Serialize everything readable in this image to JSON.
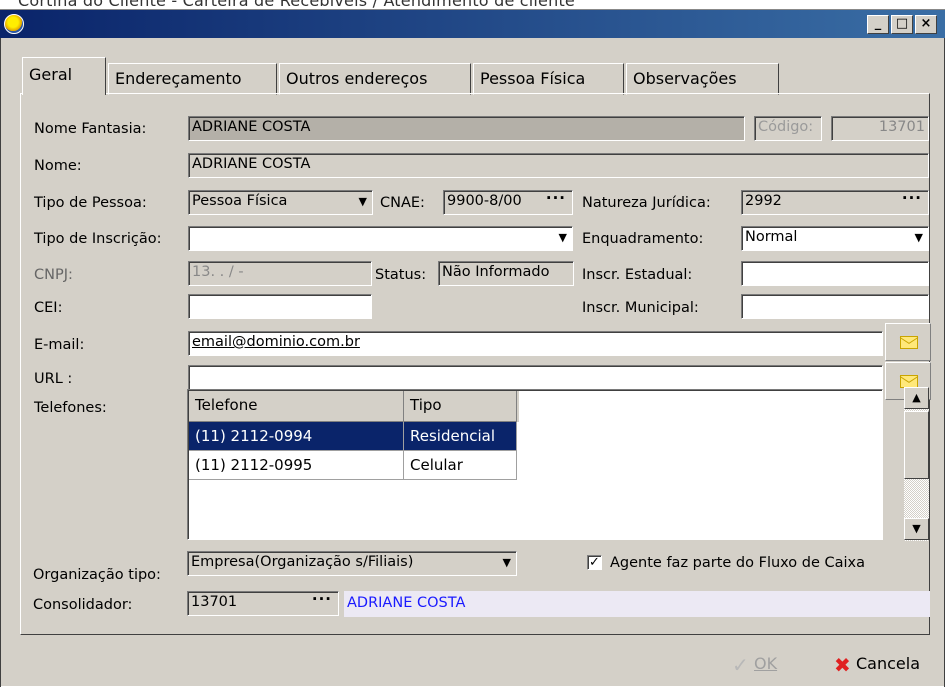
{
  "caption": "Cortina do Cliente - Carteira de Recebíveis / Atendimento de cliente",
  "window": {
    "min": "_",
    "max": "□",
    "close": "×"
  },
  "tabs": [
    {
      "label": "Geral"
    },
    {
      "label": "Endereçamento"
    },
    {
      "label": "Outros endereços"
    },
    {
      "label": "Pessoa Física"
    },
    {
      "label": "Observações"
    }
  ],
  "form": {
    "nome_fantasia_label": "Nome Fantasia:",
    "nome_fantasia": "ADRIANE COSTA",
    "codigo_label": "Código:",
    "codigo": "13701",
    "nome_label": "Nome:",
    "nome": "ADRIANE COSTA",
    "tipo_pessoa_label": "Tipo de Pessoa:",
    "tipo_pessoa": "Pessoa Física",
    "cnae_label": "CNAE:",
    "cnae": "9900-8/00",
    "natureza_label": "Natureza Jurídica:",
    "natureza": "2992",
    "tipo_inscricao_label": "Tipo de Inscrição:",
    "tipo_inscricao": "",
    "enquadramento_label": "Enquadramento:",
    "enquadramento": "Normal",
    "cnpj_label": "CNPJ:",
    "cnpj": "13.  .   /   -",
    "status_label": "Status:",
    "status": "Não Informado",
    "inscr_estadual_label": "Inscr. Estadual:",
    "inscr_estadual": "",
    "cei_label": "CEI:",
    "cei": "",
    "inscr_municipal_label": "Inscr. Municipal:",
    "inscr_municipal": "",
    "email_label": "E-mail:",
    "email": "email@dominio.com.br",
    "url_label": "URL :",
    "url": "",
    "telefones_label": "Telefones:",
    "organizacao_label": "Organização tipo:",
    "organizacao": "Empresa(Organização s/Filiais)",
    "agente_label": "Agente faz parte do Fluxo de Caixa",
    "agente_checked": true,
    "consolidador_label": "Consolidador:",
    "consolidador_codigo": "13701",
    "consolidador_nome": "ADRIANE COSTA"
  },
  "phones": {
    "columns": [
      "Telefone",
      "Tipo"
    ],
    "rows": [
      {
        "telefone": "(11) 2112-0994",
        "tipo": "Residencial",
        "selected": true
      },
      {
        "telefone": "(11) 2112-0995",
        "tipo": "Celular",
        "selected": false
      }
    ]
  },
  "footer": {
    "ok_label": "OK",
    "cancel_label": "Cancela"
  },
  "glyphs": {
    "dropdown": "▼",
    "ellipsis": "···",
    "check": "✓",
    "scroll_up": "▲",
    "scroll_down": "▼"
  },
  "colors": {
    "selection": "#0a246a",
    "consolidador_text": "#1a1aff",
    "cancel_icon": "#e02020"
  }
}
